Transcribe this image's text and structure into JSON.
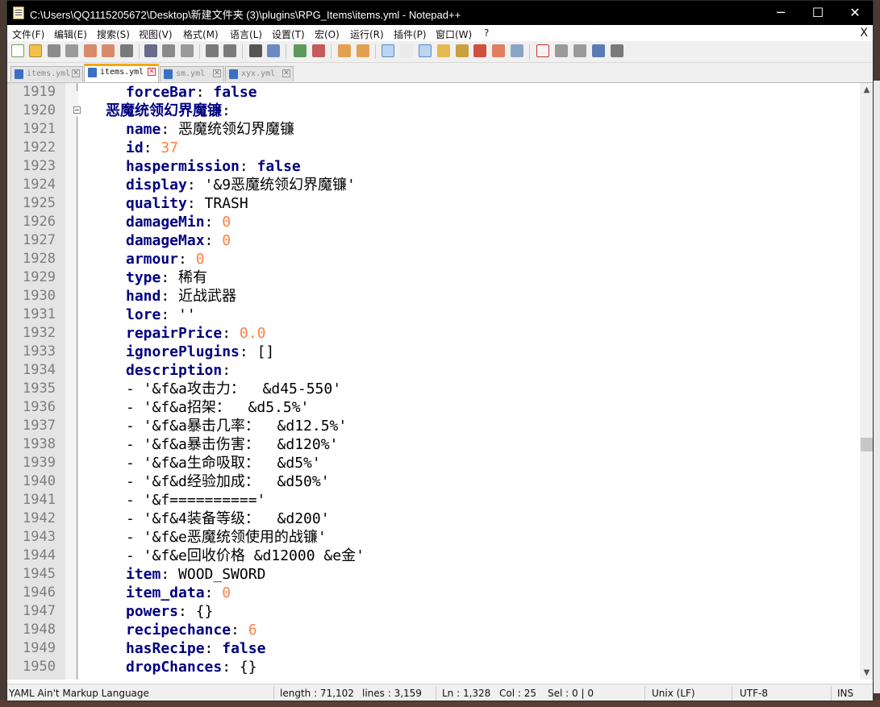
{
  "window": {
    "title": "C:\\Users\\QQ1115205672\\Desktop\\新建文件夹 (3)\\plugins\\RPG_Items\\items.yml - Notepad++",
    "minimize": "─",
    "maximize": "☐",
    "close": "✕"
  },
  "menu": {
    "items": [
      "文件(F)",
      "编辑(E)",
      "搜索(S)",
      "视图(V)",
      "格式(M)",
      "语言(L)",
      "设置(T)",
      "宏(O)",
      "运行(R)",
      "插件(P)",
      "窗口(W)",
      "?"
    ],
    "close_doc": "X"
  },
  "tabs": [
    {
      "label": "items.yml",
      "active": false
    },
    {
      "label": "items.yml",
      "active": true
    },
    {
      "label": "sm.yml",
      "active": false
    },
    {
      "label": "xyx.yml",
      "active": false
    }
  ],
  "lines": [
    {
      "n": "1919",
      "parts": [
        [
          "k",
          "forceBar"
        ],
        [
          "p",
          ": "
        ],
        [
          "b",
          "false"
        ]
      ],
      "lvl": 1
    },
    {
      "n": "1920",
      "parts": [
        [
          "k",
          "恶魔统领幻界魔镰"
        ],
        [
          "p",
          ":"
        ]
      ],
      "lvl": 0
    },
    {
      "n": "1921",
      "parts": [
        [
          "k",
          "name"
        ],
        [
          "p",
          ": 恶魔统领幻界魔镰"
        ]
      ],
      "lvl": 1
    },
    {
      "n": "1922",
      "parts": [
        [
          "k",
          "id"
        ],
        [
          "p",
          ": "
        ],
        [
          "n",
          "37"
        ]
      ],
      "lvl": 1
    },
    {
      "n": "1923",
      "parts": [
        [
          "k",
          "haspermission"
        ],
        [
          "p",
          ": "
        ],
        [
          "b",
          "false"
        ]
      ],
      "lvl": 1
    },
    {
      "n": "1924",
      "parts": [
        [
          "k",
          "display"
        ],
        [
          "p",
          ": '&9恶魔统领幻界魔镰'"
        ]
      ],
      "lvl": 1
    },
    {
      "n": "1925",
      "parts": [
        [
          "k",
          "quality"
        ],
        [
          "p",
          ": TRASH"
        ]
      ],
      "lvl": 1
    },
    {
      "n": "1926",
      "parts": [
        [
          "k",
          "damageMin"
        ],
        [
          "p",
          ": "
        ],
        [
          "n",
          "0"
        ]
      ],
      "lvl": 1
    },
    {
      "n": "1927",
      "parts": [
        [
          "k",
          "damageMax"
        ],
        [
          "p",
          ": "
        ],
        [
          "n",
          "0"
        ]
      ],
      "lvl": 1
    },
    {
      "n": "1928",
      "parts": [
        [
          "k",
          "armour"
        ],
        [
          "p",
          ": "
        ],
        [
          "n",
          "0"
        ]
      ],
      "lvl": 1
    },
    {
      "n": "1929",
      "parts": [
        [
          "k",
          "type"
        ],
        [
          "p",
          ": 稀有"
        ]
      ],
      "lvl": 1
    },
    {
      "n": "1930",
      "parts": [
        [
          "k",
          "hand"
        ],
        [
          "p",
          ": 近战武器"
        ]
      ],
      "lvl": 1
    },
    {
      "n": "1931",
      "parts": [
        [
          "k",
          "lore"
        ],
        [
          "p",
          ": ''"
        ]
      ],
      "lvl": 1
    },
    {
      "n": "1932",
      "parts": [
        [
          "k",
          "repairPrice"
        ],
        [
          "p",
          ": "
        ],
        [
          "n",
          "0.0"
        ]
      ],
      "lvl": 1
    },
    {
      "n": "1933",
      "parts": [
        [
          "k",
          "ignorePlugins"
        ],
        [
          "p",
          ": []"
        ]
      ],
      "lvl": 1
    },
    {
      "n": "1934",
      "parts": [
        [
          "k",
          "description"
        ],
        [
          "p",
          ":"
        ]
      ],
      "lvl": 1
    },
    {
      "n": "1935",
      "parts": [
        [
          "p",
          "- '&f&a攻击力：  &d45-550'"
        ]
      ],
      "lvl": 1
    },
    {
      "n": "1936",
      "parts": [
        [
          "p",
          "- '&f&a招架：  &d5.5%'"
        ]
      ],
      "lvl": 1
    },
    {
      "n": "1937",
      "parts": [
        [
          "p",
          "- '&f&a暴击几率：  &d12.5%'"
        ]
      ],
      "lvl": 1
    },
    {
      "n": "1938",
      "parts": [
        [
          "p",
          "- '&f&a暴击伤害：  &d120%'"
        ]
      ],
      "lvl": 1
    },
    {
      "n": "1939",
      "parts": [
        [
          "p",
          "- '&f&a生命吸取：  &d5%'"
        ]
      ],
      "lvl": 1
    },
    {
      "n": "1940",
      "parts": [
        [
          "p",
          "- '&f&d经验加成：  &d50%'"
        ]
      ],
      "lvl": 1
    },
    {
      "n": "1941",
      "parts": [
        [
          "p",
          "- '&f=========='"
        ]
      ],
      "lvl": 1
    },
    {
      "n": "1942",
      "parts": [
        [
          "p",
          "- '&f&4装备等级：  &d200'"
        ]
      ],
      "lvl": 1
    },
    {
      "n": "1943",
      "parts": [
        [
          "p",
          "- '&f&e恶魔统领使用的战镰'"
        ]
      ],
      "lvl": 1
    },
    {
      "n": "1944",
      "parts": [
        [
          "p",
          "- '&f&e回收价格 &d12000 &e金'"
        ]
      ],
      "lvl": 1
    },
    {
      "n": "1945",
      "parts": [
        [
          "k",
          "item"
        ],
        [
          "p",
          ": WOOD_SWORD"
        ]
      ],
      "lvl": 1
    },
    {
      "n": "1946",
      "parts": [
        [
          "k",
          "item_data"
        ],
        [
          "p",
          ": "
        ],
        [
          "n",
          "0"
        ]
      ],
      "lvl": 1
    },
    {
      "n": "1947",
      "parts": [
        [
          "k",
          "powers"
        ],
        [
          "p",
          ": {}"
        ]
      ],
      "lvl": 1
    },
    {
      "n": "1948",
      "parts": [
        [
          "k",
          "recipechance"
        ],
        [
          "p",
          ": "
        ],
        [
          "n",
          "6"
        ]
      ],
      "lvl": 1
    },
    {
      "n": "1949",
      "parts": [
        [
          "k",
          "hasRecipe"
        ],
        [
          "p",
          ": "
        ],
        [
          "b",
          "false"
        ]
      ],
      "lvl": 1
    },
    {
      "n": "1950",
      "parts": [
        [
          "k",
          "dropChances"
        ],
        [
          "p",
          ": {}"
        ]
      ],
      "lvl": 1
    }
  ],
  "status": {
    "language": "YAML Ain't Markup Language",
    "length": "length : 71,102",
    "lines": "lines : 3,159",
    "ln": "Ln : 1,328",
    "col": "Col : 25",
    "sel": "Sel : 0 | 0",
    "eol": "Unix (LF)",
    "encoding": "UTF-8",
    "mode": "INS"
  },
  "scroll": {
    "up": "▲",
    "down": "▼",
    "position_fraction": 0.6
  },
  "colors": {
    "keyword": "#000080",
    "number": "#ff8040",
    "tab_accent": "#f7a800",
    "titlebar": "#000000"
  }
}
